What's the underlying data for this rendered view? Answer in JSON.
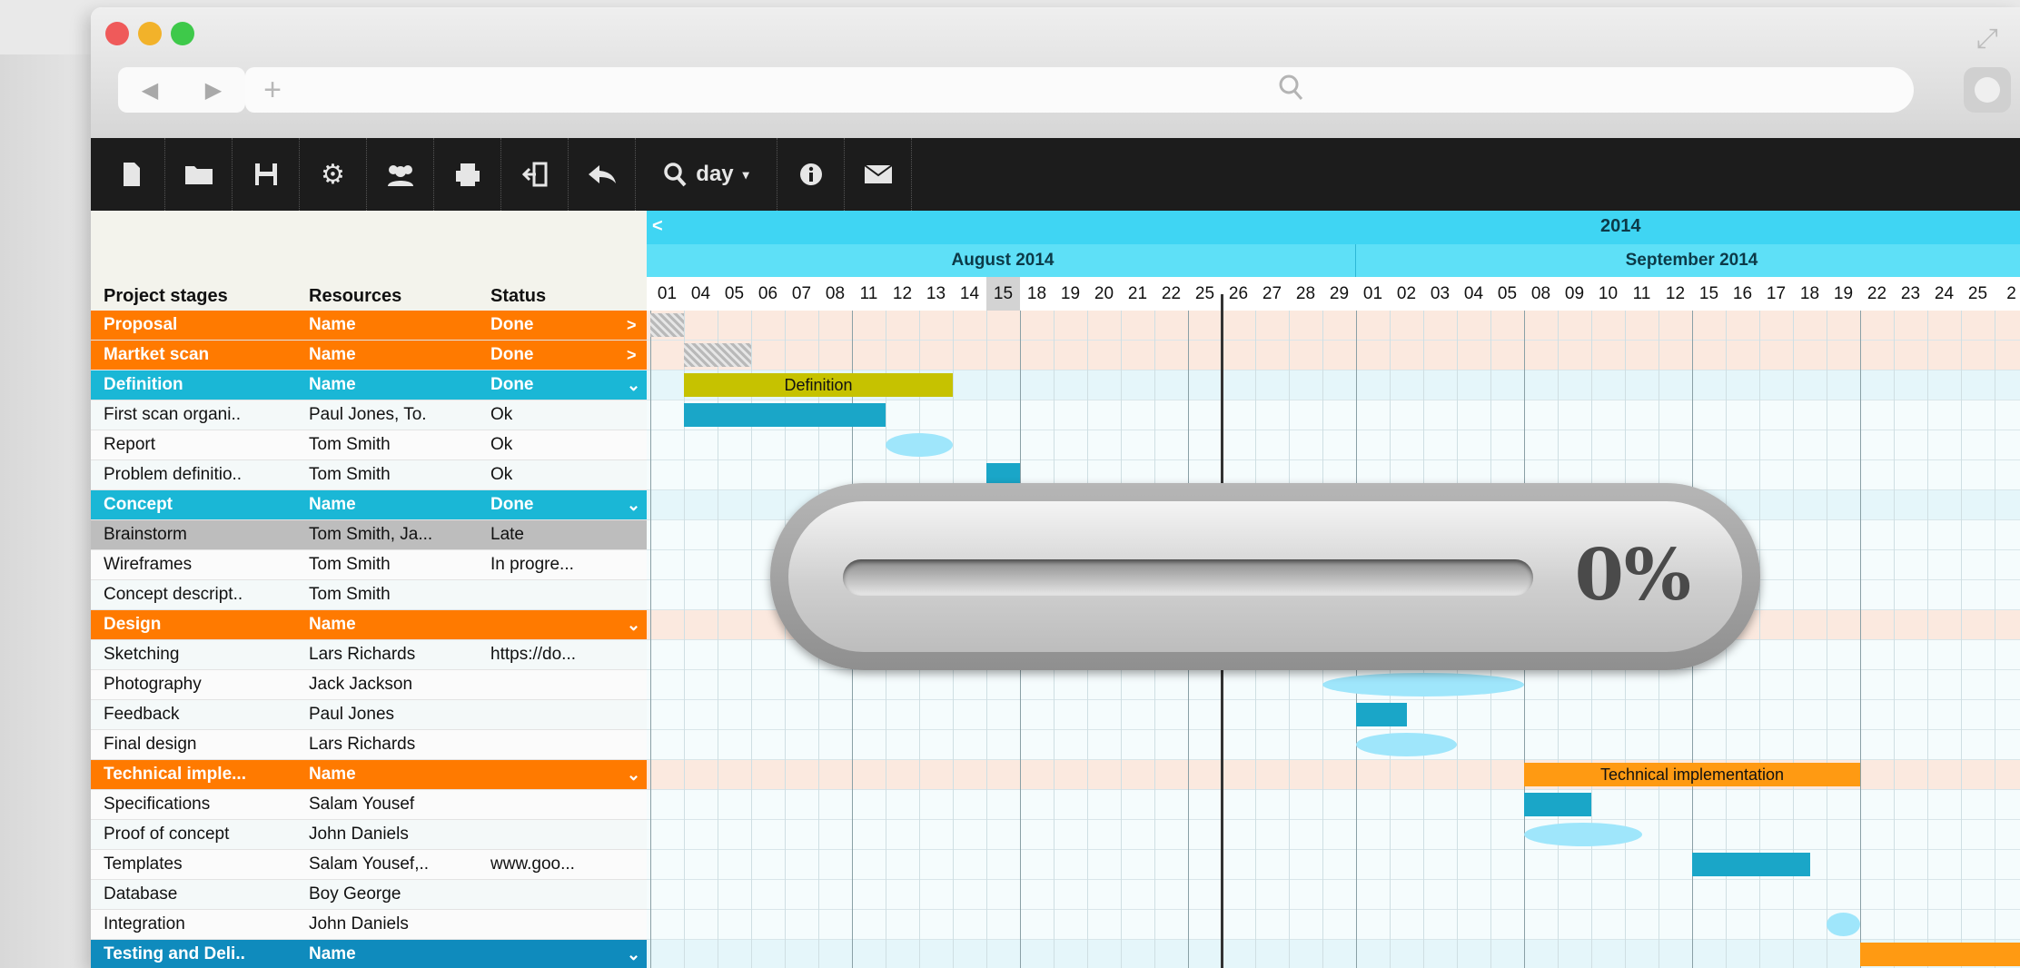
{
  "browser": {
    "nav_back": "◀",
    "nav_forward": "▶",
    "new_tab": "+",
    "reload": "↻",
    "search_icon": "search-icon"
  },
  "toolbar": {
    "zoom_label": "day",
    "icons": [
      "new-file-icon",
      "open-folder-icon",
      "save-icon",
      "settings-icon",
      "users-icon",
      "print-icon",
      "exit-icon",
      "undo-icon",
      "zoom-icon",
      "info-icon",
      "mail-icon"
    ]
  },
  "grid": {
    "headers": {
      "stage": "Project stages",
      "resources": "Resources",
      "status": "Status"
    },
    "rows": [
      {
        "type": "group",
        "color": "orange",
        "stage": "Proposal",
        "resources": "Name",
        "status": "Done",
        "chevron": ">"
      },
      {
        "type": "group",
        "color": "orange",
        "stage": "Martket scan",
        "resources": "Name",
        "status": "Done",
        "chevron": ">"
      },
      {
        "type": "group",
        "color": "blue",
        "stage": "Definition",
        "resources": "Name",
        "status": "Done",
        "chevron": "⌄"
      },
      {
        "type": "task",
        "stage": "First scan organi..",
        "resources": "Paul Jones, To.",
        "status": "Ok"
      },
      {
        "type": "task",
        "stage": "Report",
        "resources": "Tom Smith",
        "status": "Ok"
      },
      {
        "type": "task",
        "stage": "Problem definitio..",
        "resources": "Tom Smith",
        "status": "Ok"
      },
      {
        "type": "group",
        "color": "blue",
        "stage": "Concept",
        "resources": "Name",
        "status": "Done",
        "chevron": "⌄"
      },
      {
        "type": "grey",
        "stage": "Brainstorm",
        "resources": "Tom Smith, Ja...",
        "status": "Late"
      },
      {
        "type": "task",
        "stage": "Wireframes",
        "resources": "Tom Smith",
        "status": "In progre..."
      },
      {
        "type": "task",
        "stage": "Concept descript..",
        "resources": "Tom Smith",
        "status": ""
      },
      {
        "type": "group",
        "color": "orange",
        "stage": "Design",
        "resources": "Name",
        "status": "",
        "chevron": "⌄"
      },
      {
        "type": "task",
        "stage": "Sketching",
        "resources": "Lars Richards",
        "status": "https://do..."
      },
      {
        "type": "task",
        "stage": "Photography",
        "resources": "Jack Jackson",
        "status": ""
      },
      {
        "type": "task",
        "stage": "Feedback",
        "resources": "Paul Jones",
        "status": ""
      },
      {
        "type": "task",
        "stage": "Final design",
        "resources": "Lars Richards",
        "status": ""
      },
      {
        "type": "group",
        "color": "orange",
        "stage": "Technical imple...",
        "resources": "Name",
        "status": "",
        "chevron": "⌄"
      },
      {
        "type": "task",
        "stage": "Specifications",
        "resources": "Salam Yousef",
        "status": ""
      },
      {
        "type": "task",
        "stage": "Proof of concept",
        "resources": "John Daniels",
        "status": ""
      },
      {
        "type": "task",
        "stage": "Templates",
        "resources": "Salam Yousef,..",
        "status": "www.goo..."
      },
      {
        "type": "task",
        "stage": "Database",
        "resources": "Boy George",
        "status": ""
      },
      {
        "type": "task",
        "stage": "Integration",
        "resources": "John Daniels",
        "status": ""
      },
      {
        "type": "group",
        "color": "dblue",
        "stage": "Testing and Deli..",
        "resources": "Name",
        "status": "",
        "chevron": "⌄"
      }
    ]
  },
  "timeline": {
    "year": "2014",
    "nav_prev": "<",
    "months": [
      {
        "label": "August 2014",
        "start": 0,
        "days": 21
      },
      {
        "label": "September 2014",
        "start": 21,
        "days": 20
      }
    ],
    "days": [
      "01",
      "04",
      "05",
      "06",
      "07",
      "08",
      "11",
      "12",
      "13",
      "14",
      "15",
      "18",
      "19",
      "20",
      "21",
      "22",
      "25",
      "26",
      "27",
      "28",
      "29",
      "01",
      "02",
      "03",
      "04",
      "05",
      "08",
      "09",
      "10",
      "11",
      "12",
      "15",
      "16",
      "17",
      "18",
      "19",
      "22",
      "23",
      "24",
      "25",
      "2"
    ],
    "highlight_day_index": 10,
    "bars": [
      {
        "row": 0,
        "start": 0,
        "end": 1,
        "style": "hatch",
        "label": ""
      },
      {
        "row": 1,
        "start": 1,
        "end": 3,
        "style": "hatch",
        "label": ""
      },
      {
        "row": 2,
        "start": 1,
        "end": 9,
        "style": "olive",
        "label": "Definition"
      },
      {
        "row": 3,
        "start": 1,
        "end": 7,
        "style": "cyan",
        "label": ""
      },
      {
        "row": 4,
        "start": 7,
        "end": 9,
        "style": "light",
        "label": ""
      },
      {
        "row": 5,
        "start": 10,
        "end": 11,
        "style": "cyan",
        "label": ""
      },
      {
        "row": 11,
        "start": 16,
        "end": 19.5,
        "style": "cyan",
        "label": ""
      },
      {
        "row": 12,
        "start": 20,
        "end": 26,
        "style": "light",
        "label": ""
      },
      {
        "row": 13,
        "start": 21,
        "end": 22.5,
        "style": "cyan",
        "label": ""
      },
      {
        "row": 14,
        "start": 21,
        "end": 24,
        "style": "light",
        "label": ""
      },
      {
        "row": 15,
        "start": 26,
        "end": 36,
        "style": "orange",
        "label": "Technical implementation"
      },
      {
        "row": 16,
        "start": 26,
        "end": 28,
        "style": "cyan",
        "label": ""
      },
      {
        "row": 17,
        "start": 26,
        "end": 29.5,
        "style": "light",
        "label": ""
      },
      {
        "row": 18,
        "start": 31,
        "end": 34.5,
        "style": "cyan",
        "label": ""
      },
      {
        "row": 20,
        "start": 35,
        "end": 36,
        "style": "light",
        "label": ""
      },
      {
        "row": 21,
        "start": 36,
        "end": 41,
        "style": "orange",
        "label": ""
      }
    ]
  },
  "loader": {
    "percent_text": "0%",
    "progress": 0
  }
}
